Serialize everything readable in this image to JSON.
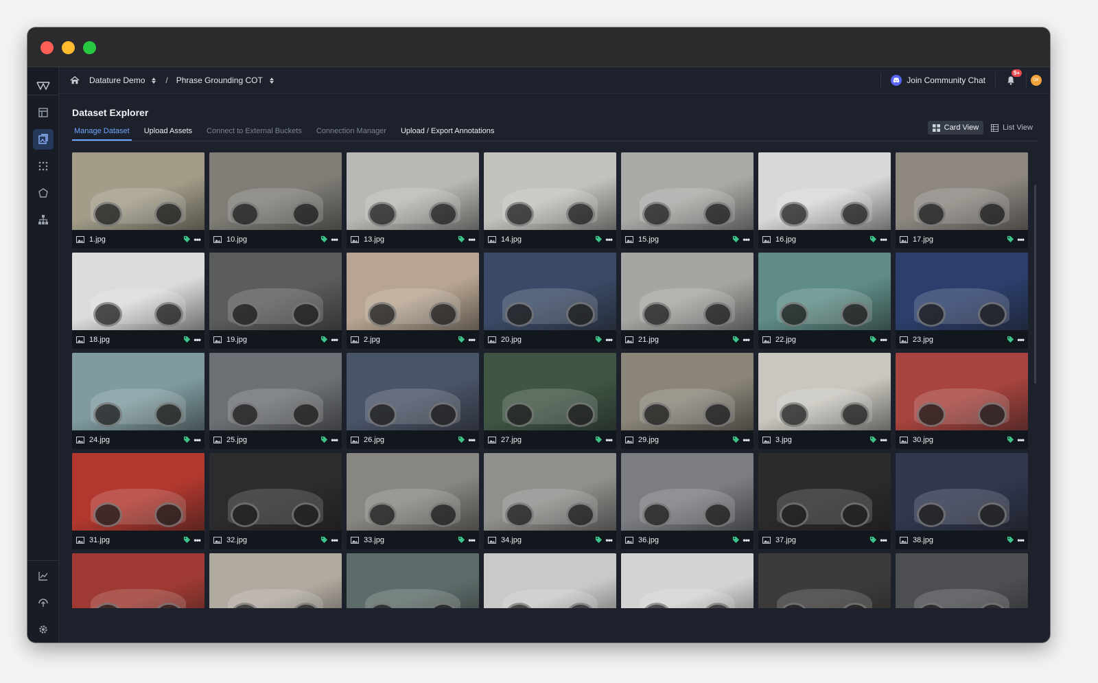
{
  "breadcrumb": {
    "home_icon": "home-icon",
    "org": "Datature Demo",
    "separator": "/",
    "project": "Phrase Grounding COT"
  },
  "header": {
    "community": "Join Community Chat",
    "notifications_badge": "9+",
    "avatar_initials": "DK"
  },
  "page": {
    "title": "Dataset Explorer"
  },
  "tabs": [
    {
      "label": "Manage Dataset",
      "state": "active"
    },
    {
      "label": "Upload Assets",
      "state": "normal"
    },
    {
      "label": "Connect to External Buckets",
      "state": "muted"
    },
    {
      "label": "Connection Manager",
      "state": "muted"
    },
    {
      "label": "Upload / Export Annotations",
      "state": "normal"
    }
  ],
  "views": {
    "card": "Card View",
    "list": "List View",
    "selected": "card"
  },
  "sidebar": {
    "items": [
      "table-icon",
      "dataset-icon",
      "grid-dots-icon",
      "tag-shape-icon",
      "hierarchy-icon"
    ],
    "bottom_items": [
      "chart-icon",
      "deploy-icon",
      "gear-icon"
    ],
    "active_index": 1
  },
  "colors": {
    "accent": "#6ea8fe",
    "tag": "#3ec38a",
    "panel": "#1c212b"
  },
  "assets": [
    {
      "name": "1.jpg",
      "color": "#a29c88"
    },
    {
      "name": "10.jpg",
      "color": "#7f7d76"
    },
    {
      "name": "13.jpg",
      "color": "#b9b8b4"
    },
    {
      "name": "14.jpg",
      "color": "#c4c2bd"
    },
    {
      "name": "15.jpg",
      "color": "#a9a9a6"
    },
    {
      "name": "16.jpg",
      "color": "#d8d8d6"
    },
    {
      "name": "17.jpg",
      "color": "#8d8780"
    },
    {
      "name": "18.jpg",
      "color": "#dcdcdb"
    },
    {
      "name": "19.jpg",
      "color": "#5a5d5c"
    },
    {
      "name": "2.jpg",
      "color": "#b7a591"
    },
    {
      "name": "20.jpg",
      "color": "#3a4a66"
    },
    {
      "name": "21.jpg",
      "color": "#a6a5a2"
    },
    {
      "name": "22.jpg",
      "color": "#5f8c86"
    },
    {
      "name": "23.jpg",
      "color": "#2c3f6c"
    },
    {
      "name": "24.jpg",
      "color": "#7f9ba0"
    },
    {
      "name": "25.jpg",
      "color": "#6d7075"
    },
    {
      "name": "26.jpg",
      "color": "#4a5468"
    },
    {
      "name": "27.jpg",
      "color": "#3f5645"
    },
    {
      "name": "29.jpg",
      "color": "#8b8579"
    },
    {
      "name": "3.jpg",
      "color": "#c9c7bf"
    },
    {
      "name": "30.jpg",
      "color": "#a8443f"
    },
    {
      "name": "31.jpg",
      "color": "#b2382f"
    },
    {
      "name": "32.jpg",
      "color": "#2c2c2e"
    },
    {
      "name": "33.jpg",
      "color": "#888680"
    },
    {
      "name": "34.jpg",
      "color": "#8f8f8c"
    },
    {
      "name": "36.jpg",
      "color": "#7b7d82"
    },
    {
      "name": "37.jpg",
      "color": "#2b2b2c"
    },
    {
      "name": "38.jpg",
      "color": "#30374e"
    },
    {
      "name": "",
      "color": "#9e3a33"
    },
    {
      "name": "",
      "color": "#b1aaa0"
    },
    {
      "name": "",
      "color": "#5d6c6a"
    },
    {
      "name": "",
      "color": "#c9c9c8"
    },
    {
      "name": "",
      "color": "#d4d4d2"
    },
    {
      "name": "",
      "color": "#3d3b3a"
    },
    {
      "name": "",
      "color": "#4d4e52"
    }
  ]
}
